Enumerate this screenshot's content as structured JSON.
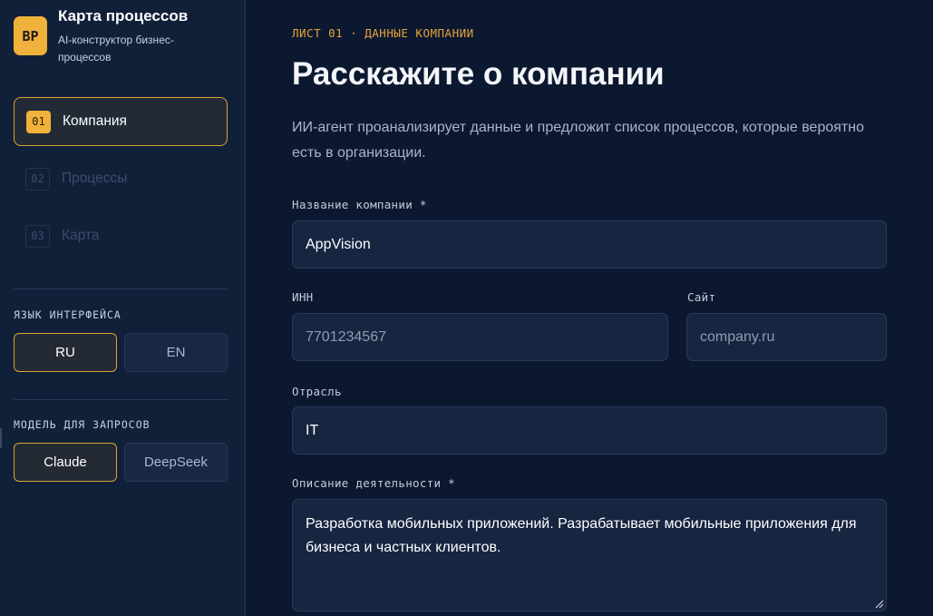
{
  "brand": {
    "logo": "BP",
    "title": "Карта процессов",
    "subtitle": "AI-конструктор бизнес-процессов"
  },
  "steps": [
    {
      "num": "01",
      "label": "Компания",
      "active": true
    },
    {
      "num": "02",
      "label": "Процессы",
      "active": false
    },
    {
      "num": "03",
      "label": "Карта",
      "active": false
    }
  ],
  "language": {
    "label": "ЯЗЫК ИНТЕРФЕЙСА",
    "options": [
      "RU",
      "EN"
    ],
    "selected": "RU"
  },
  "model": {
    "label": "МОДЕЛЬ ДЛЯ ЗАПРОСОВ",
    "options": [
      "Claude",
      "DeepSeek"
    ],
    "selected": "Claude"
  },
  "main": {
    "eyebrow": "ЛИСТ 01 · ДАННЫЕ КОМПАНИИ",
    "title": "Расскажите о компании",
    "intro": "ИИ-агент проанализирует данные и предложит список процессов, которые вероятно есть в организации."
  },
  "form": {
    "company_name": {
      "label": "Название компании *",
      "value": "AppVision"
    },
    "inn": {
      "label": "ИНН",
      "placeholder": "7701234567"
    },
    "site": {
      "label": "Сайт",
      "placeholder": "company.ru"
    },
    "industry": {
      "label": "Отрасль",
      "value": "IT"
    },
    "description": {
      "label": "Описание деятельности *",
      "value": "Разработка мобильных приложений. Разрабатывает мобильные приложения для бизнеса и частных клиентов."
    }
  },
  "colors": {
    "accent": "#f0b23a",
    "background": "#0c1830",
    "sidebar": "#112039",
    "input": "#172541"
  }
}
